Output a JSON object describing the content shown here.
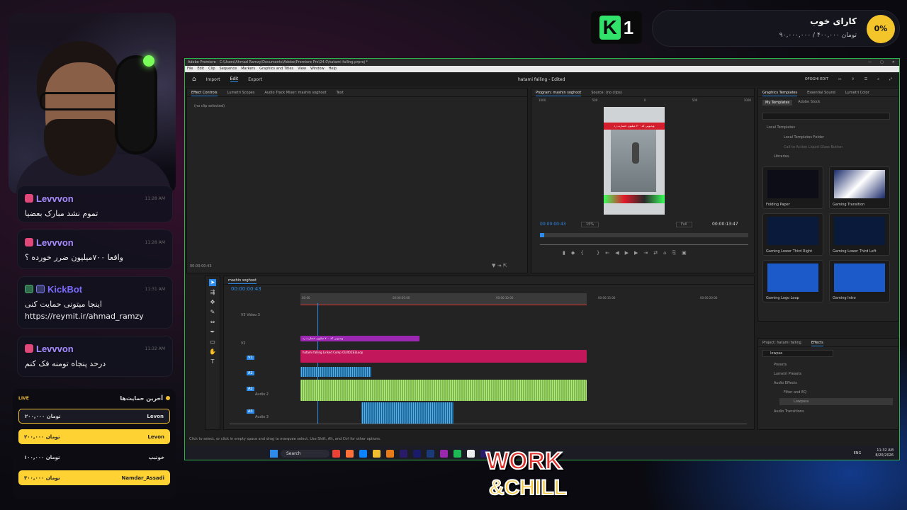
{
  "stream": {
    "goal": {
      "title": "کارای خوب",
      "amount": "۹۰,۰۰۰,۰۰۰ / ۴۰۰,۰۰۰ تومان",
      "percent": "0%"
    },
    "k1": {
      "logo_letter": "K",
      "number": "1"
    },
    "chat": [
      {
        "user": "Levvvon",
        "time": "11:28 AM",
        "msg": "تموم نشد مبارک بعضیا"
      },
      {
        "user": "Levvvon",
        "time": "11:28 AM",
        "msg": "واقعا ۷۰۰میلیون ضرر خورده ؟"
      },
      {
        "user": "KickBot",
        "time": "11:31 AM",
        "msg": "اینجا میتونی حمایت کنی",
        "link": "https://reymit.ir/ahmad_ramzy"
      },
      {
        "user": "Levvvon",
        "time": "11:32 AM",
        "msg": "درحد پنجاه تومنه فک کنم"
      }
    ],
    "donations": {
      "live": "LIVE",
      "title": "آخرین حمایت‌ها",
      "rows": [
        {
          "amount": "۲۰۰,۰۰۰ تومان",
          "name": "Levon"
        },
        {
          "amount": "۲۰۰,۰۰۰ تومان",
          "name": "Levon"
        },
        {
          "amount": "۱۰۰,۰۰۰ تومان",
          "name": "خوتیپ"
        },
        {
          "amount": "۳۰۰,۰۰۰ تومان",
          "name": "Namdar_Assadi"
        }
      ]
    },
    "logo": {
      "line1": "WORK",
      "line2": "&CHILL"
    }
  },
  "premiere": {
    "titlebar": "Adobe Premiere - C:\\Users\\Ahmad Ramzy\\Documents\\Adobe\\Premiere Pro\\24.0\\hatami falling.prproj *",
    "menu": [
      "File",
      "Edit",
      "Clip",
      "Sequence",
      "Markers",
      "Graphics and Titles",
      "View",
      "Window",
      "Help"
    ],
    "nav": {
      "home": "⌂",
      "import": "Import",
      "edit": "Edit",
      "export": "Export",
      "project": "hatami falling - Edited",
      "user": "OFOGHI EDIT"
    },
    "effect_tabs": [
      "Effect Controls",
      "Lumetri Scopes",
      "Audio Track Mixer: mashin soghoot",
      "Text"
    ],
    "no_clip": "(no clip selected)",
    "ec_time": "00:00:00:43",
    "program_tabs": [
      "Program: mashin soghoot",
      "Source: (no clips)"
    ],
    "preview_banner": "ویدیویی که ۷۰۰ میلیون خسارت زد",
    "program": {
      "time": "00:00:00:43",
      "zoom": "15%",
      "quality": "Full",
      "duration": "00:00:13:47"
    },
    "ruler_labels": {
      "r1": "1000",
      "r2": "500",
      "r3": "0",
      "r4": "500",
      "r5": "1000"
    },
    "graphics_tabs": [
      "Graphics Templates",
      "Essential Sound",
      "Lumetri Color"
    ],
    "gt_sub": [
      "My Templates",
      "Adobe Stock"
    ],
    "gt_tree": [
      "Local Templates",
      "Local Templates Folder",
      "Call to Action Liquid Glass Button",
      "Libraries"
    ],
    "templates": [
      "Folding Paper",
      "Gaming Transition",
      "Gaming Lower Third Right",
      "Gaming Lower Third Left",
      "Gaming Logo Loop",
      "Gaming Intro"
    ],
    "effects": {
      "tabs": [
        "Project: hatami falling",
        "Effects"
      ],
      "search": "lowpas",
      "tree": [
        "Presets",
        "Lumetri Presets",
        "Audio Effects",
        "Filter and EQ",
        "Lowpass",
        "Audio Transitions"
      ]
    },
    "timeline": {
      "name": "mashin soghoot",
      "time": "00:00:00:43",
      "ticks": [
        "00:00",
        "00:00:05:00",
        "00:00:10:00",
        "00:00:15:00",
        "00:00:20:00"
      ],
      "tracks": [
        "V3",
        "V2",
        "V1",
        "A1",
        "A2",
        "A3"
      ],
      "track_names": {
        "v3": "Video 3",
        "a2": "Audio 2",
        "a3": "Audio 3"
      },
      "clip_v2": "ویدیویی که ۷۰۰ میلیون خسارت زد",
      "clip_v1": "hatami falling Linked Comp 01/It0ZE3Loop",
      "fx": "fx"
    },
    "status": "Click to select, or click in empty space and drag to marquee select. Use Shift, Alt, and Ctrl for other options.",
    "taskbar": {
      "search": "Search",
      "lang": "ENG",
      "time": "11:32 AM",
      "date": "8/20/2026"
    },
    "colors": {
      "accent": "#2d8ceb",
      "video_clip": "#c2185b",
      "v2_clip": "#9c27b0",
      "audio": "#7ebc4a"
    }
  }
}
